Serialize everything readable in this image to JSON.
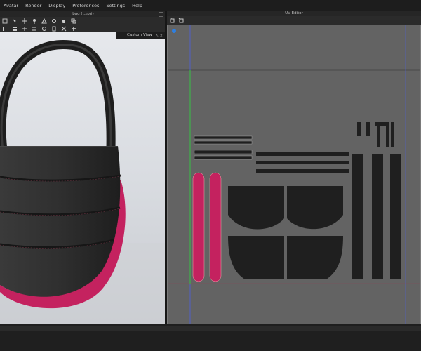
{
  "menu": {
    "items": [
      "Avatar",
      "Render",
      "Display",
      "Preferences",
      "Settings",
      "Help"
    ]
  },
  "left_panel": {
    "tab_title": "bag (t.zprj)",
    "custom_view_label": "Custom View",
    "custom_view_controls": "↖ ×"
  },
  "uv_editor": {
    "title": "UV Editor"
  },
  "icons": {
    "toolbar1": [
      "cube-icon",
      "select-icon",
      "move-icon",
      "pin-icon",
      "fold-icon",
      "tack-icon",
      "hand-icon",
      "copy-icon"
    ],
    "toolbar2": [
      "grid-icon",
      "layout-icon",
      "align-icon",
      "flip-icon",
      "rotate-icon",
      "stack-icon",
      "arrange-icon",
      "add-icon"
    ],
    "uv_toolbar": [
      "uv-select-icon",
      "uv-transform-icon"
    ]
  },
  "colors": {
    "fabric_dark": "#2f2f2f",
    "fabric_pink": "#c4225f",
    "uv_background": "#636363",
    "uv_piece": "#1f1f1f",
    "uv_axis_green": "#3fb24a",
    "uv_axis_blue": "#4d5fe0"
  }
}
